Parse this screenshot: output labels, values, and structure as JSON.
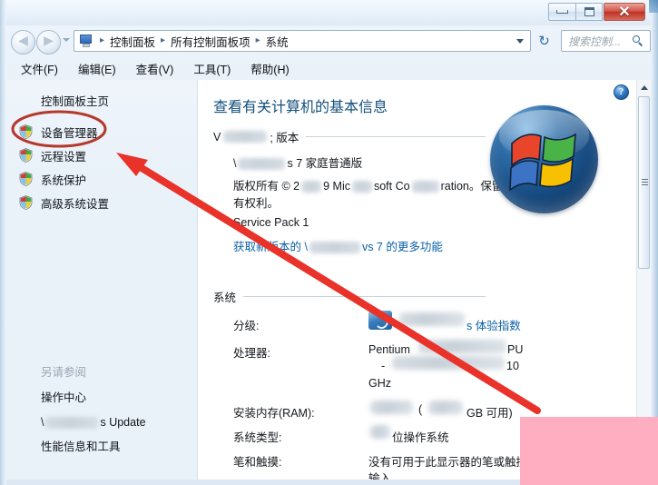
{
  "window": {
    "buttons": {
      "minimize": "minimize-button",
      "maximize": "maximize-button",
      "close_glyph": "✕"
    }
  },
  "navbar": {
    "back_glyph": "◀",
    "forward_glyph": "▶",
    "breadcrumb": {
      "icon": "computer-icon",
      "items": [
        "控制面板",
        "所有控制面板项",
        "系统"
      ],
      "separator": "▸"
    },
    "refresh_glyph": "↻",
    "search": {
      "placeholder": "搜索控制...",
      "icon": "search-icon"
    }
  },
  "menubar": {
    "items": [
      "文件(F)",
      "编辑(E)",
      "查看(V)",
      "工具(T)",
      "帮助(H)"
    ]
  },
  "sidebar": {
    "home": "控制面板主页",
    "items": [
      {
        "label": "设备管理器",
        "icon": "uac-shield-icon"
      },
      {
        "label": "远程设置",
        "icon": "uac-shield-icon"
      },
      {
        "label": "系统保护",
        "icon": "uac-shield-icon"
      },
      {
        "label": "高级系统设置",
        "icon": "uac-shield-icon"
      }
    ],
    "see_also_title": "另请参阅",
    "see_also": [
      {
        "label": "操作中心",
        "redacted": false
      },
      {
        "label": "s Update",
        "prefix": "\\",
        "redacted": true
      },
      {
        "label": "性能信息和工具",
        "redacted": false
      }
    ]
  },
  "content": {
    "help_glyph": "?",
    "title": "查看有关计算机的基本信息",
    "windows_edition": {
      "heading_prefix": "V",
      "heading_suffix": "; 版本",
      "edition_prefix": "\\",
      "edition_suffix": "s 7 家庭普通版",
      "copyright_parts": [
        "版权所有 © 2",
        "9 Mic",
        "soft Co",
        "ration。保留所",
        "有权利。"
      ],
      "service_pack": "Service Pack 1",
      "upgrade_link_parts": [
        "获取新版本的 \\",
        "vs 7 的更多功能"
      ]
    },
    "system": {
      "heading": "系统",
      "rows": [
        {
          "label": "分级:",
          "value": "s 体验指数",
          "type": "rating-link",
          "icon": "rating-icon"
        },
        {
          "label": "处理器:",
          "value": "Pentium",
          "value2": "-",
          "value3": "PU",
          "value4": "10",
          "value5": "GHz",
          "type": "multiline"
        },
        {
          "label": "安装内存(RAM):",
          "value": "(",
          "value2": "GB 可用)",
          "type": "redacted"
        },
        {
          "label": "系统类型:",
          "value": "位操作系统",
          "type": "redacted"
        },
        {
          "label": "笔和触摸:",
          "value": "没有可用于此显示器的笔或触控",
          "value2": "输入",
          "type": "multiline"
        }
      ]
    }
  },
  "scrollbar": {
    "up_arrow": "scroll-up-arrow",
    "down_arrow": "scroll-down-arrow",
    "thumb": "scroll-thumb"
  },
  "annotations": {
    "ellipse": {
      "target": "设备管理器",
      "color": "#c0392b"
    },
    "arrow": {
      "color": "#e8322a",
      "points_to": "设备管理器"
    },
    "redaction_box": {
      "color": "#ffaec2"
    }
  }
}
